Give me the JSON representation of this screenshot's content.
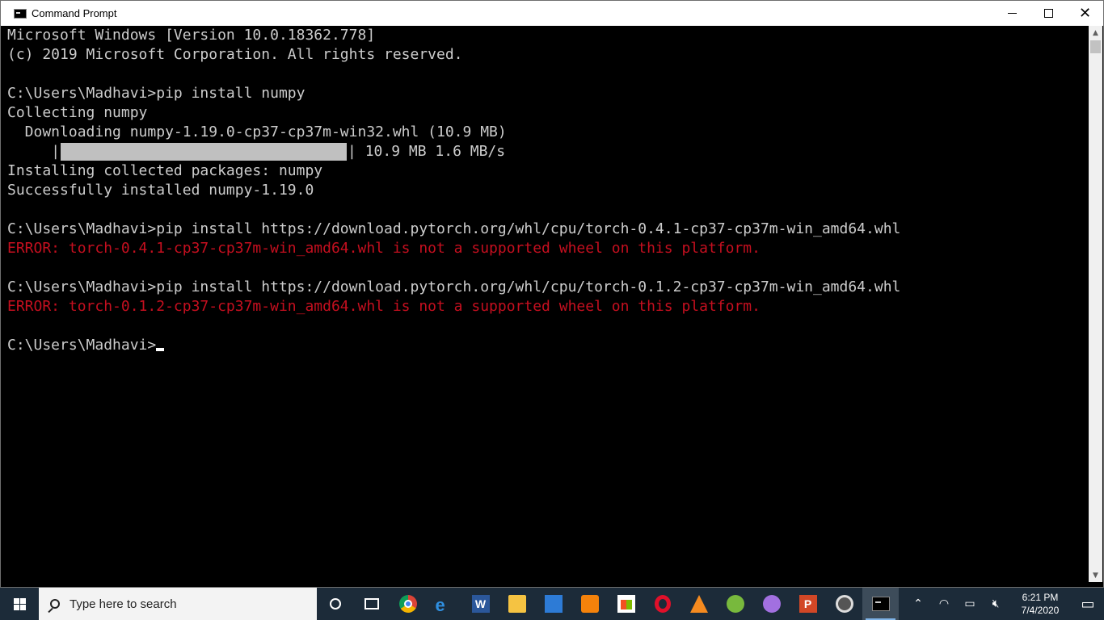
{
  "window": {
    "title": "Command Prompt",
    "controls": {
      "minimize": "minimize",
      "maximize": "maximize",
      "close": "close"
    }
  },
  "console": {
    "lines": [
      {
        "text": "Microsoft Windows [Version 10.0.18362.778]",
        "type": "normal"
      },
      {
        "text": "(c) 2019 Microsoft Corporation. All rights reserved.",
        "type": "normal"
      },
      {
        "text": "",
        "type": "normal"
      },
      {
        "text": "C:\\Users\\Madhavi>pip install numpy",
        "type": "normal"
      },
      {
        "text": "Collecting numpy",
        "type": "normal"
      },
      {
        "text": "  Downloading numpy-1.19.0-cp37-cp37m-win32.whl (10.9 MB)",
        "type": "normal"
      },
      {
        "text": "10.9 MB 1.6 MB/s",
        "type": "progress",
        "prefix": "     "
      },
      {
        "text": "Installing collected packages: numpy",
        "type": "normal"
      },
      {
        "text": "Successfully installed numpy-1.19.0",
        "type": "normal"
      },
      {
        "text": "",
        "type": "normal"
      },
      {
        "text": "C:\\Users\\Madhavi>pip install https://download.pytorch.org/whl/cpu/torch-0.4.1-cp37-cp37m-win_amd64.whl",
        "type": "normal"
      },
      {
        "text": "ERROR: torch-0.4.1-cp37-cp37m-win_amd64.whl is not a supported wheel on this platform.",
        "type": "error"
      },
      {
        "text": "",
        "type": "normal"
      },
      {
        "text": "C:\\Users\\Madhavi>pip install https://download.pytorch.org/whl/cpu/torch-0.1.2-cp37-cp37m-win_amd64.whl",
        "type": "normal"
      },
      {
        "text": "ERROR: torch-0.1.2-cp37-cp37m-win_amd64.whl is not a supported wheel on this platform.",
        "type": "error"
      },
      {
        "text": "",
        "type": "normal"
      },
      {
        "text": "C:\\Users\\Madhavi>",
        "type": "prompt"
      }
    ],
    "progress_fraction": 1.0,
    "colors": {
      "text": "#cccccc",
      "error": "#c50f1f",
      "background": "#000000"
    }
  },
  "taskbar": {
    "search_placeholder": "Type here to search",
    "apps": [
      {
        "name": "cortana-icon"
      },
      {
        "name": "task-view-icon"
      },
      {
        "name": "chrome-icon"
      },
      {
        "name": "edge-icon"
      },
      {
        "name": "word-icon"
      },
      {
        "name": "file-explorer-icon"
      },
      {
        "name": "mail-icon"
      },
      {
        "name": "sublime-text-icon"
      },
      {
        "name": "store-icon"
      },
      {
        "name": "opera-icon"
      },
      {
        "name": "vlc-icon"
      },
      {
        "name": "paint-icon"
      },
      {
        "name": "app-icon"
      },
      {
        "name": "powerpoint-icon"
      },
      {
        "name": "media-player-icon"
      },
      {
        "name": "command-prompt-icon",
        "active": true
      }
    ],
    "clock": {
      "time": "6:21 PM",
      "date": "7/4/2020"
    },
    "colors": {
      "taskbar": "#1c2b39",
      "active": "#3d4c5a",
      "accent": "#7fb3e6"
    }
  }
}
